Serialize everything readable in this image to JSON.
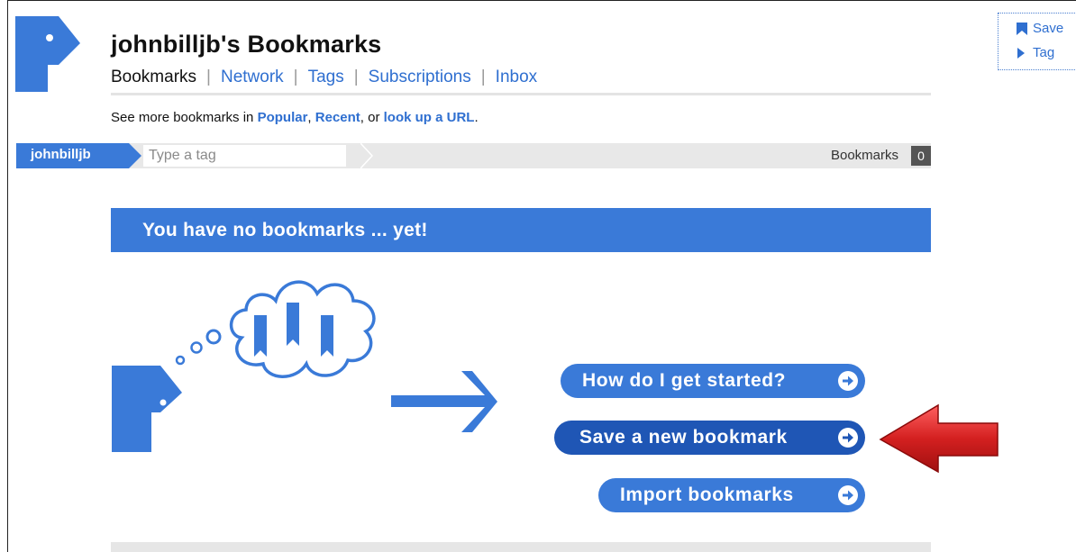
{
  "header": {
    "title": "johnbilljb's Bookmarks",
    "nav": [
      {
        "label": "Bookmarks",
        "active": true
      },
      {
        "label": "Network",
        "active": false
      },
      {
        "label": "Tags",
        "active": false
      },
      {
        "label": "Subscriptions",
        "active": false
      },
      {
        "label": "Inbox",
        "active": false
      }
    ],
    "nav_separator": "|"
  },
  "see_more": {
    "prefix": "See more bookmarks in ",
    "popular": "Popular",
    "comma1": ", ",
    "recent": "Recent",
    "or": ", or ",
    "lookup": "look up a URL",
    "suffix": "."
  },
  "tagbar": {
    "username": "johnbilljb",
    "tag_placeholder": "Type a tag",
    "bookmarks_label": "Bookmarks",
    "bookmarks_count": "0"
  },
  "sidebar": {
    "items": [
      {
        "label": "Save",
        "icon": "bookmark-flag-icon"
      },
      {
        "label": "Tag",
        "icon": "triangle-right-icon"
      }
    ]
  },
  "main": {
    "banner": "You have no bookmarks ... yet!",
    "buttons": [
      {
        "label": "How do I get started?",
        "icon": "circle-arrow-right-icon"
      },
      {
        "label": "Save a new bookmark",
        "icon": "circle-arrow-right-icon"
      },
      {
        "label": "Import bookmarks",
        "icon": "circle-arrow-right-icon"
      }
    ]
  },
  "colors": {
    "brand_blue": "#3a7ad8",
    "link_blue": "#2f6fd0",
    "highlight_arrow": "#d42c2c"
  }
}
